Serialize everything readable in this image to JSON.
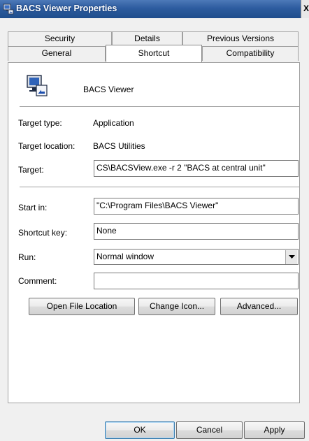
{
  "window": {
    "title": "BACS Viewer Properties",
    "close_glyph": "X",
    "icon": "app-shortcut-icon"
  },
  "tabs": {
    "row1": [
      {
        "label": "Security"
      },
      {
        "label": "Details"
      },
      {
        "label": "Previous Versions"
      }
    ],
    "row2": [
      {
        "label": "General"
      },
      {
        "label": "Shortcut"
      },
      {
        "label": "Compatibility"
      }
    ],
    "active": "Shortcut"
  },
  "shortcut": {
    "name": "BACS Viewer",
    "icon": "bacs-viewer-icon",
    "target_type_label": "Target type:",
    "target_type_value": "Application",
    "target_location_label": "Target location:",
    "target_location_value": "BACS Utilities",
    "target_label": "Target:",
    "target_value": "CS\\BACSView.exe -r 2 \"BACS at central unit\"",
    "start_in_label": "Start in:",
    "start_in_value": "\"C:\\Program Files\\BACS Viewer\"",
    "shortcut_key_label": "Shortcut key:",
    "shortcut_key_value": "None",
    "run_label": "Run:",
    "run_value": "Normal window",
    "comment_label": "Comment:",
    "comment_value": "",
    "buttons": {
      "open_file_location": "Open File Location",
      "change_icon": "Change Icon...",
      "advanced": "Advanced..."
    }
  },
  "footer": {
    "ok": "OK",
    "cancel": "Cancel",
    "apply": "Apply"
  },
  "colors": {
    "titlebar": "#2d5c9f",
    "panel": "#ffffff",
    "dialog_bg": "#f0f0f0"
  }
}
